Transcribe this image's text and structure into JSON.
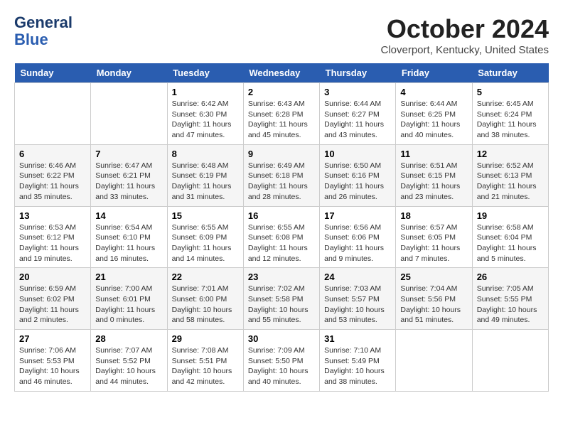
{
  "header": {
    "logo_line1": "General",
    "logo_line2": "Blue",
    "month": "October 2024",
    "location": "Cloverport, Kentucky, United States"
  },
  "weekdays": [
    "Sunday",
    "Monday",
    "Tuesday",
    "Wednesday",
    "Thursday",
    "Friday",
    "Saturday"
  ],
  "weeks": [
    [
      {
        "day": "",
        "info": ""
      },
      {
        "day": "",
        "info": ""
      },
      {
        "day": "1",
        "info": "Sunrise: 6:42 AM\nSunset: 6:30 PM\nDaylight: 11 hours and 47 minutes."
      },
      {
        "day": "2",
        "info": "Sunrise: 6:43 AM\nSunset: 6:28 PM\nDaylight: 11 hours and 45 minutes."
      },
      {
        "day": "3",
        "info": "Sunrise: 6:44 AM\nSunset: 6:27 PM\nDaylight: 11 hours and 43 minutes."
      },
      {
        "day": "4",
        "info": "Sunrise: 6:44 AM\nSunset: 6:25 PM\nDaylight: 11 hours and 40 minutes."
      },
      {
        "day": "5",
        "info": "Sunrise: 6:45 AM\nSunset: 6:24 PM\nDaylight: 11 hours and 38 minutes."
      }
    ],
    [
      {
        "day": "6",
        "info": "Sunrise: 6:46 AM\nSunset: 6:22 PM\nDaylight: 11 hours and 35 minutes."
      },
      {
        "day": "7",
        "info": "Sunrise: 6:47 AM\nSunset: 6:21 PM\nDaylight: 11 hours and 33 minutes."
      },
      {
        "day": "8",
        "info": "Sunrise: 6:48 AM\nSunset: 6:19 PM\nDaylight: 11 hours and 31 minutes."
      },
      {
        "day": "9",
        "info": "Sunrise: 6:49 AM\nSunset: 6:18 PM\nDaylight: 11 hours and 28 minutes."
      },
      {
        "day": "10",
        "info": "Sunrise: 6:50 AM\nSunset: 6:16 PM\nDaylight: 11 hours and 26 minutes."
      },
      {
        "day": "11",
        "info": "Sunrise: 6:51 AM\nSunset: 6:15 PM\nDaylight: 11 hours and 23 minutes."
      },
      {
        "day": "12",
        "info": "Sunrise: 6:52 AM\nSunset: 6:13 PM\nDaylight: 11 hours and 21 minutes."
      }
    ],
    [
      {
        "day": "13",
        "info": "Sunrise: 6:53 AM\nSunset: 6:12 PM\nDaylight: 11 hours and 19 minutes."
      },
      {
        "day": "14",
        "info": "Sunrise: 6:54 AM\nSunset: 6:10 PM\nDaylight: 11 hours and 16 minutes."
      },
      {
        "day": "15",
        "info": "Sunrise: 6:55 AM\nSunset: 6:09 PM\nDaylight: 11 hours and 14 minutes."
      },
      {
        "day": "16",
        "info": "Sunrise: 6:55 AM\nSunset: 6:08 PM\nDaylight: 11 hours and 12 minutes."
      },
      {
        "day": "17",
        "info": "Sunrise: 6:56 AM\nSunset: 6:06 PM\nDaylight: 11 hours and 9 minutes."
      },
      {
        "day": "18",
        "info": "Sunrise: 6:57 AM\nSunset: 6:05 PM\nDaylight: 11 hours and 7 minutes."
      },
      {
        "day": "19",
        "info": "Sunrise: 6:58 AM\nSunset: 6:04 PM\nDaylight: 11 hours and 5 minutes."
      }
    ],
    [
      {
        "day": "20",
        "info": "Sunrise: 6:59 AM\nSunset: 6:02 PM\nDaylight: 11 hours and 2 minutes."
      },
      {
        "day": "21",
        "info": "Sunrise: 7:00 AM\nSunset: 6:01 PM\nDaylight: 11 hours and 0 minutes."
      },
      {
        "day": "22",
        "info": "Sunrise: 7:01 AM\nSunset: 6:00 PM\nDaylight: 10 hours and 58 minutes."
      },
      {
        "day": "23",
        "info": "Sunrise: 7:02 AM\nSunset: 5:58 PM\nDaylight: 10 hours and 55 minutes."
      },
      {
        "day": "24",
        "info": "Sunrise: 7:03 AM\nSunset: 5:57 PM\nDaylight: 10 hours and 53 minutes."
      },
      {
        "day": "25",
        "info": "Sunrise: 7:04 AM\nSunset: 5:56 PM\nDaylight: 10 hours and 51 minutes."
      },
      {
        "day": "26",
        "info": "Sunrise: 7:05 AM\nSunset: 5:55 PM\nDaylight: 10 hours and 49 minutes."
      }
    ],
    [
      {
        "day": "27",
        "info": "Sunrise: 7:06 AM\nSunset: 5:53 PM\nDaylight: 10 hours and 46 minutes."
      },
      {
        "day": "28",
        "info": "Sunrise: 7:07 AM\nSunset: 5:52 PM\nDaylight: 10 hours and 44 minutes."
      },
      {
        "day": "29",
        "info": "Sunrise: 7:08 AM\nSunset: 5:51 PM\nDaylight: 10 hours and 42 minutes."
      },
      {
        "day": "30",
        "info": "Sunrise: 7:09 AM\nSunset: 5:50 PM\nDaylight: 10 hours and 40 minutes."
      },
      {
        "day": "31",
        "info": "Sunrise: 7:10 AM\nSunset: 5:49 PM\nDaylight: 10 hours and 38 minutes."
      },
      {
        "day": "",
        "info": ""
      },
      {
        "day": "",
        "info": ""
      }
    ]
  ]
}
